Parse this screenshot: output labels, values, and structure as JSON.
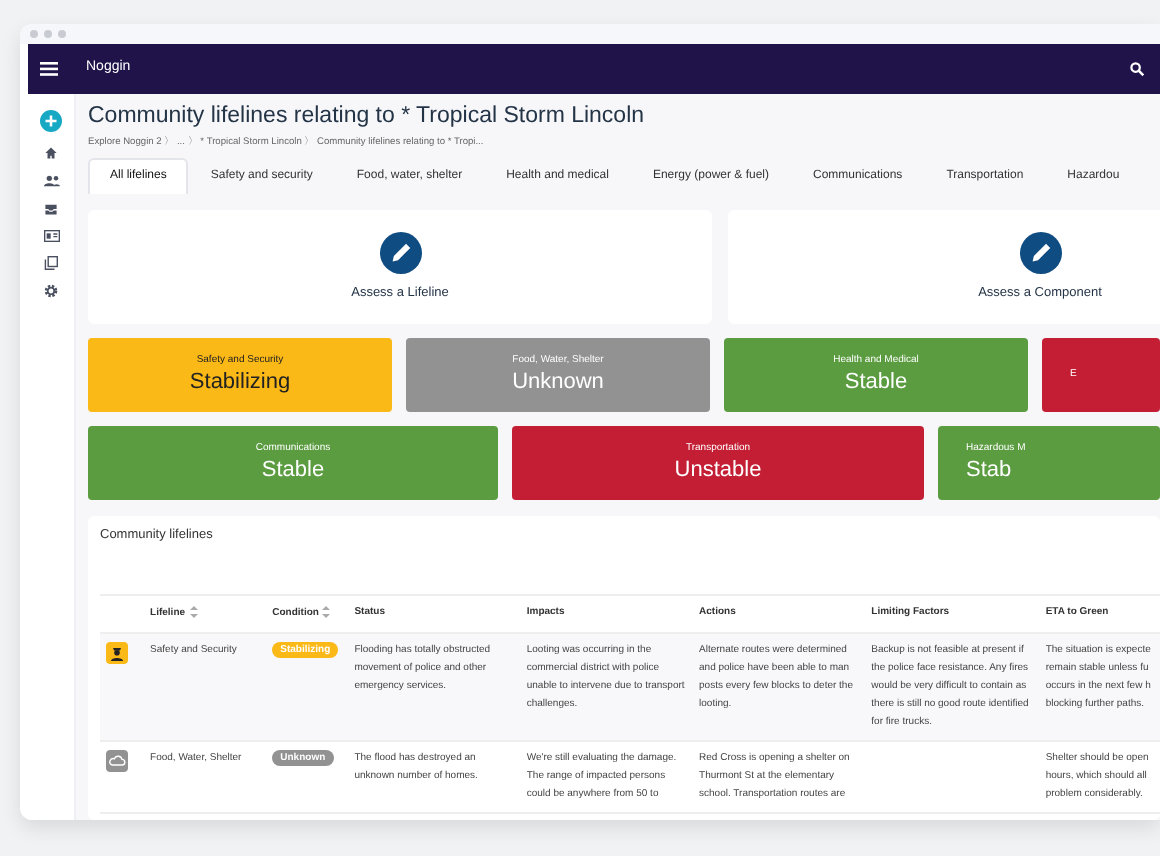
{
  "app": {
    "title": "Noggin"
  },
  "page": {
    "title": "Community lifelines relating to * Tropical Storm Lincoln",
    "breadcrumb": "Explore Noggin 2 〉 ... 〉 * Tropical Storm Lincoln 〉 Community lifelines relating to * Tropi..."
  },
  "tabs": [
    {
      "label": "All lifelines",
      "selected": true
    },
    {
      "label": "Safety and security",
      "selected": false
    },
    {
      "label": "Food, water, shelter",
      "selected": false
    },
    {
      "label": "Health and medical",
      "selected": false
    },
    {
      "label": "Energy (power & fuel)",
      "selected": false
    },
    {
      "label": "Communications",
      "selected": false
    },
    {
      "label": "Transportation",
      "selected": false
    },
    {
      "label": "Hazardou",
      "selected": false
    }
  ],
  "actions": [
    {
      "label": "Assess a Lifeline"
    },
    {
      "label": "Assess a Component"
    }
  ],
  "tile_rows": [
    [
      {
        "name": "Safety and Security",
        "condition": "Stabilizing",
        "color": "#fbb917"
      },
      {
        "name": "Food, Water, Shelter",
        "condition": "Unknown",
        "color": "#929292"
      },
      {
        "name": "Health and Medical",
        "condition": "Stable",
        "color": "#5b9c40"
      },
      {
        "name": "E",
        "color": "#c41e34"
      }
    ],
    [
      {
        "name": "Communications",
        "condition": "Stable",
        "color": "#5b9c40"
      },
      {
        "name": "Transportation",
        "condition": "Unstable",
        "color": "#c41e34"
      },
      {
        "name": "Hazardous M",
        "condition": "Stab",
        "color": "#5b9c40"
      }
    ]
  ],
  "table": {
    "title": "Community lifelines",
    "columns": [
      {
        "label": "Lifeline",
        "sortable": true
      },
      {
        "label": "Condition",
        "sortable": true
      },
      {
        "label": "Status",
        "sortable": false
      },
      {
        "label": "Impacts",
        "sortable": false
      },
      {
        "label": "Actions",
        "sortable": false
      },
      {
        "label": "Limiting Factors",
        "sortable": false
      },
      {
        "label": "ETA to Green",
        "sortable": false
      }
    ],
    "rows": [
      {
        "kind": "police",
        "color": "#fbb917",
        "lifeline": "Safety and Security",
        "condition": "Stabilizing",
        "status": "Flooding has totally obstructed movement of police and other emergency services.",
        "impacts": "Looting was occurring in the commercial district with police unable to intervene due to transport challenges.",
        "actions": "Alternate routes were determined and police have been able to man posts every few blocks to deter the looting.",
        "limiting_factors": "Backup is not feasible at present if the police face resistance. Any fires would be very difficult to contain as there is still no good route identified for fire trucks.",
        "eta": "The situation is expecte\nremain stable unless fu\noccurs in the next few h\nblocking further paths."
      },
      {
        "kind": "shelter",
        "color": "#929292",
        "lifeline": "Food, Water, Shelter",
        "condition": "Unknown",
        "status": "The flood has destroyed an unknown number of homes.",
        "impacts": "We're still evaluating the damage. The range of impacted persons could be anywhere from 50 to",
        "actions": "Red Cross is opening a shelter on Thurmont St at the elementary school. Transportation routes are",
        "eta": "Shelter should be open\nhours, which should all\nproblem considerably."
      }
    ]
  }
}
